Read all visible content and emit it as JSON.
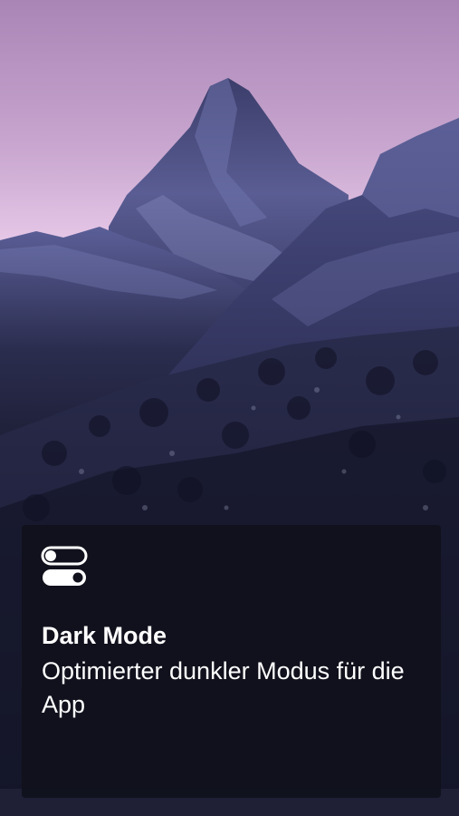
{
  "background": {
    "image": "matterhorn-mountain-dusk",
    "sky_top": "#b08bb8",
    "sky_bottom": "#e6c6e6",
    "mountain_color": "#3e4174"
  },
  "feature_card": {
    "icon": "toggle-switches-icon",
    "title": "Dark Mode",
    "description": "Optimierter dunkler Modus für die App",
    "background": "#10111c",
    "text_color": "#ffffff"
  }
}
